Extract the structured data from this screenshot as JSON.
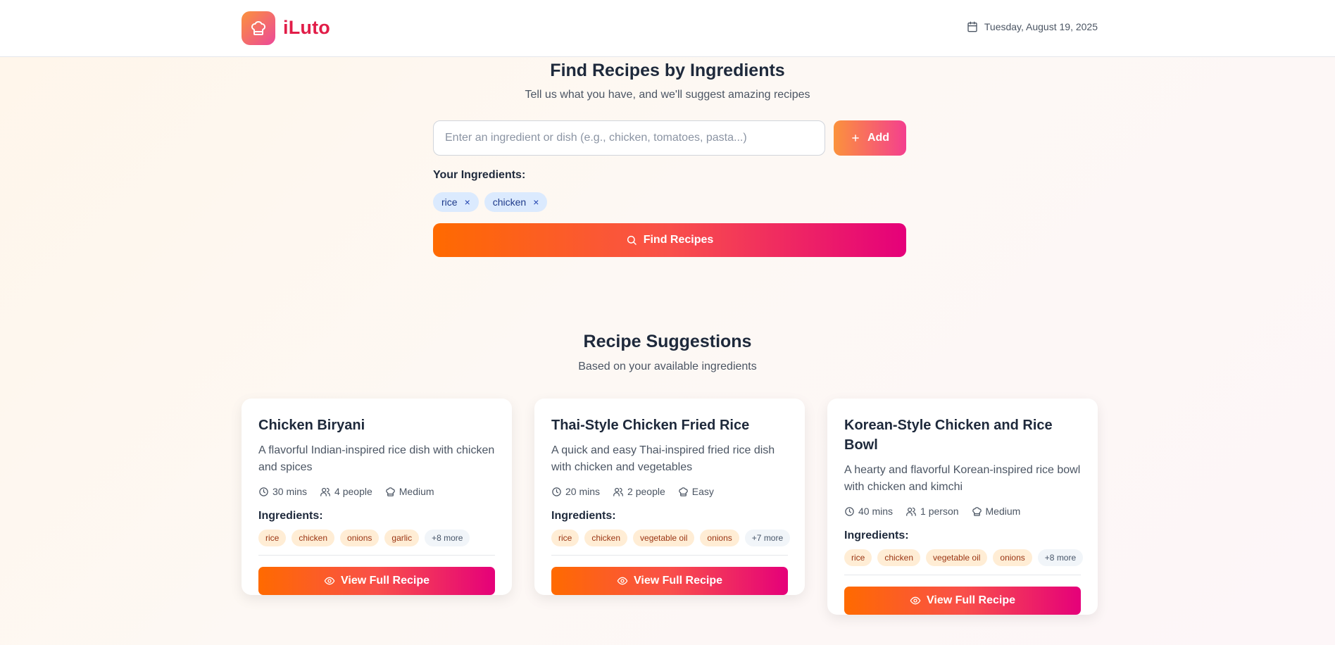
{
  "app": {
    "name": "iLuto",
    "date": "Tuesday, August 19, 2025"
  },
  "search": {
    "title": "Find Recipes by Ingredients",
    "subtitle": "Tell us what you have, and we'll suggest amazing recipes",
    "placeholder": "Enter an ingredient or dish (e.g., chicken, tomatoes, pasta...)",
    "value": "",
    "add_label": "Add",
    "ingredients_label": "Your Ingredients:",
    "ingredients": [
      "rice",
      "chicken"
    ],
    "remove_symbol": "×",
    "find_label": "Find Recipes"
  },
  "suggestions": {
    "title": "Recipe Suggestions",
    "subtitle": "Based on your available ingredients",
    "ingredients_label": "Ingredients:",
    "view_label": "View Full Recipe",
    "recipes": [
      {
        "title": "Chicken Biryani",
        "description": "A flavorful Indian-inspired rice dish with chicken and spices",
        "time": "30 mins",
        "servings": "4 people",
        "difficulty": "Medium",
        "ingredients": [
          "rice",
          "chicken",
          "onions",
          "garlic"
        ],
        "more": "+8 more"
      },
      {
        "title": "Thai-Style Chicken Fried Rice",
        "description": "A quick and easy Thai-inspired fried rice dish with chicken and vegetables",
        "time": "20 mins",
        "servings": "2 people",
        "difficulty": "Easy",
        "ingredients": [
          "rice",
          "chicken",
          "vegetable oil",
          "onions"
        ],
        "more": "+7 more"
      },
      {
        "title": "Korean-Style Chicken and Rice Bowl",
        "description": "A hearty and flavorful Korean-inspired rice bowl with chicken and kimchi",
        "time": "40 mins",
        "servings": "1 person",
        "difficulty": "Medium",
        "ingredients": [
          "rice",
          "chicken",
          "vegetable oil",
          "onions"
        ],
        "more": "+8 more"
      }
    ]
  },
  "icons": {
    "logo": "chef-hat-icon",
    "date": "calendar-icon",
    "add": "plus-icon",
    "find": "search-icon",
    "time": "clock-icon",
    "servings": "users-icon",
    "difficulty": "chef-hat-icon",
    "view": "eye-icon"
  },
  "colors": {
    "brand": "#e11d48",
    "gradient_start": "#ff6a00",
    "gradient_end": "#e5007a",
    "chip_bg": "#dbeafe",
    "tag_bg": "#ffedd5"
  }
}
